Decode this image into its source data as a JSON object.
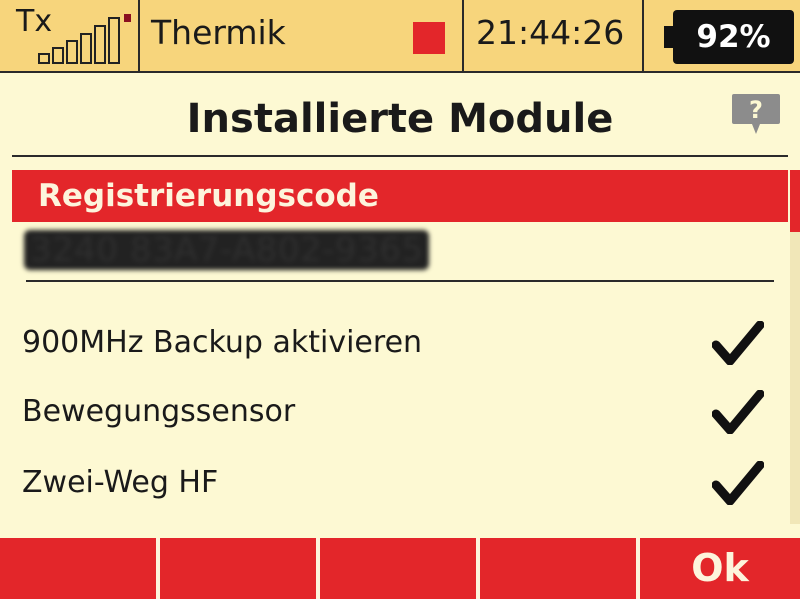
{
  "status_bar": {
    "tx_label": "Tx",
    "model_name": "Thermik",
    "time": "21:44:26",
    "battery_percent": "92%",
    "battery_level": 0.92
  },
  "title": "Installierte Module",
  "help_icon": "help-speech-bubble-icon",
  "section": {
    "header": "Registrierungscode",
    "code": "3240 83A7-A802-9365"
  },
  "modules": [
    {
      "label": "900MHz Backup aktivieren",
      "enabled": true
    },
    {
      "label": "Bewegungssensor",
      "enabled": true
    },
    {
      "label": "Zwei-Weg HF",
      "enabled": true
    }
  ],
  "softkeys": [
    "",
    "",
    "",
    "",
    "Ok"
  ],
  "colors": {
    "background": "#fdf9d3",
    "status_bar": "#f7d57c",
    "accent_red": "#e3262a",
    "text": "#1a1a1a"
  }
}
